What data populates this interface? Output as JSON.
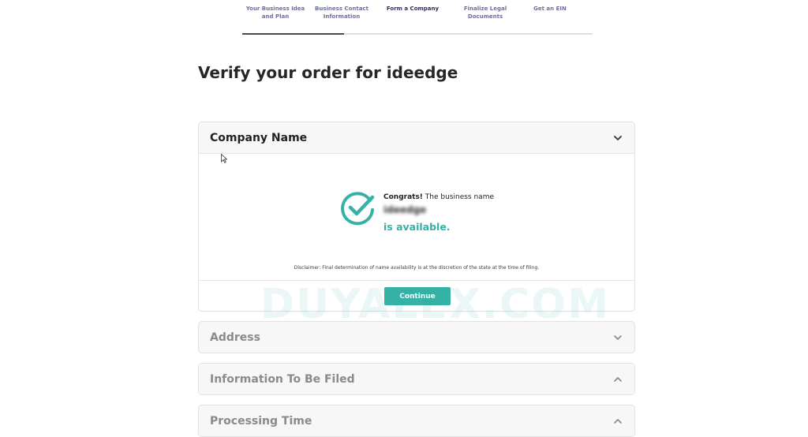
{
  "steps": [
    {
      "label": "Your Business Idea and Plan",
      "active": false
    },
    {
      "label": "Business Contact Information",
      "active": false
    },
    {
      "label": "Form a Company",
      "active": true
    },
    {
      "label": "Finalize Legal Documents",
      "active": false
    },
    {
      "label": "Get an EIN",
      "active": false
    }
  ],
  "progress": {
    "completed_fraction": 0.29
  },
  "page": {
    "title": "Verify your order for ideedge"
  },
  "company_panel": {
    "title": "Company Name",
    "congrats_bold": "Congrats!",
    "congrats_rest": " The business name",
    "business_name": "ideedge",
    "available_text": "is available.",
    "disclaimer": "Disclaimer: Final determination of name availability is at the discretion of the state at the time of filing.",
    "continue_label": "Continue",
    "icon": "check-circle-icon"
  },
  "collapsed_panels": [
    {
      "title": "Address",
      "chevron": "chevron-down-icon"
    },
    {
      "title": "Information To Be Filed",
      "chevron": "chevron-up-icon"
    },
    {
      "title": "Processing Time",
      "chevron": "chevron-up-icon"
    }
  ],
  "watermark": "DUYALEX.COM",
  "colors": {
    "accent": "#35b1a5",
    "step_text": "#6d6f9a",
    "progress": "#4a4a4a"
  }
}
